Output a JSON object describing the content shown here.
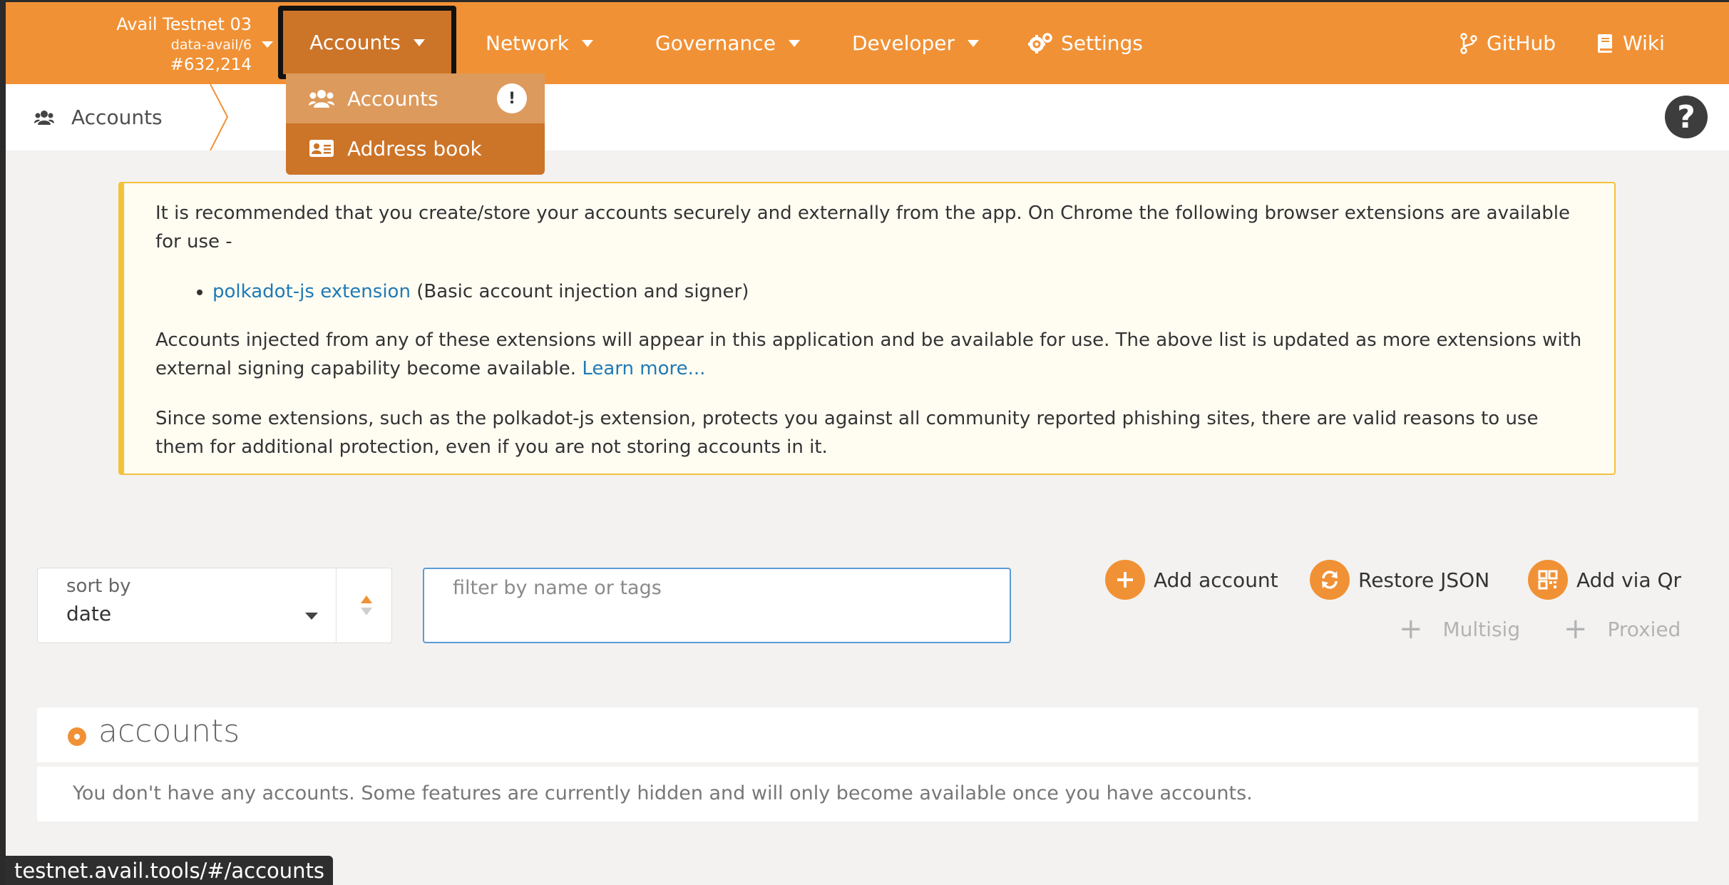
{
  "chain": {
    "name": "Avail Testnet 03",
    "spec": "data-avail/6",
    "block": "#632,214"
  },
  "nav": {
    "accounts": "Accounts",
    "network": "Network",
    "governance": "Governance",
    "developer": "Developer",
    "settings": "Settings",
    "github": "GitHub",
    "wiki": "Wiki"
  },
  "dropdown": {
    "accounts": "Accounts",
    "badge": "!",
    "address_book": "Address book"
  },
  "subheader": {
    "tab": "Accounts"
  },
  "info": {
    "p1": "It is recommended that you create/store your accounts securely and externally from the app. On Chrome the following browser extensions are available for use -",
    "ext_link": "polkadot-js extension",
    "ext_desc": " (Basic account injection and signer)",
    "p2": "Accounts injected from any of these extensions will appear in this application and be available for use. The above list is updated as more extensions with external signing capability become available. ",
    "learn_more": "Learn more...",
    "p3": "Since some extensions, such as the polkadot-js extension, protects you against all community reported phishing sites, there are valid reasons to use them for additional protection, even if you are not storing accounts in it."
  },
  "sort": {
    "label": "sort by",
    "value": "date"
  },
  "filter": {
    "placeholder": "filter by name or tags",
    "value": ""
  },
  "actions": {
    "add_account": "Add account",
    "restore_json": "Restore JSON",
    "add_via_qr": "Add via Qr",
    "multisig": "Multisig",
    "proxied": "Proxied"
  },
  "accounts_section": {
    "title": "accounts",
    "empty": "You don't have any accounts. Some features are currently hidden and will only become available once you have accounts."
  },
  "status_url": "testnet.avail.tools/#/accounts",
  "colors": {
    "accent": "#f19135",
    "accent_dark": "#cc7428",
    "info_border": "#f4c13b",
    "link": "#1f7ab5"
  }
}
